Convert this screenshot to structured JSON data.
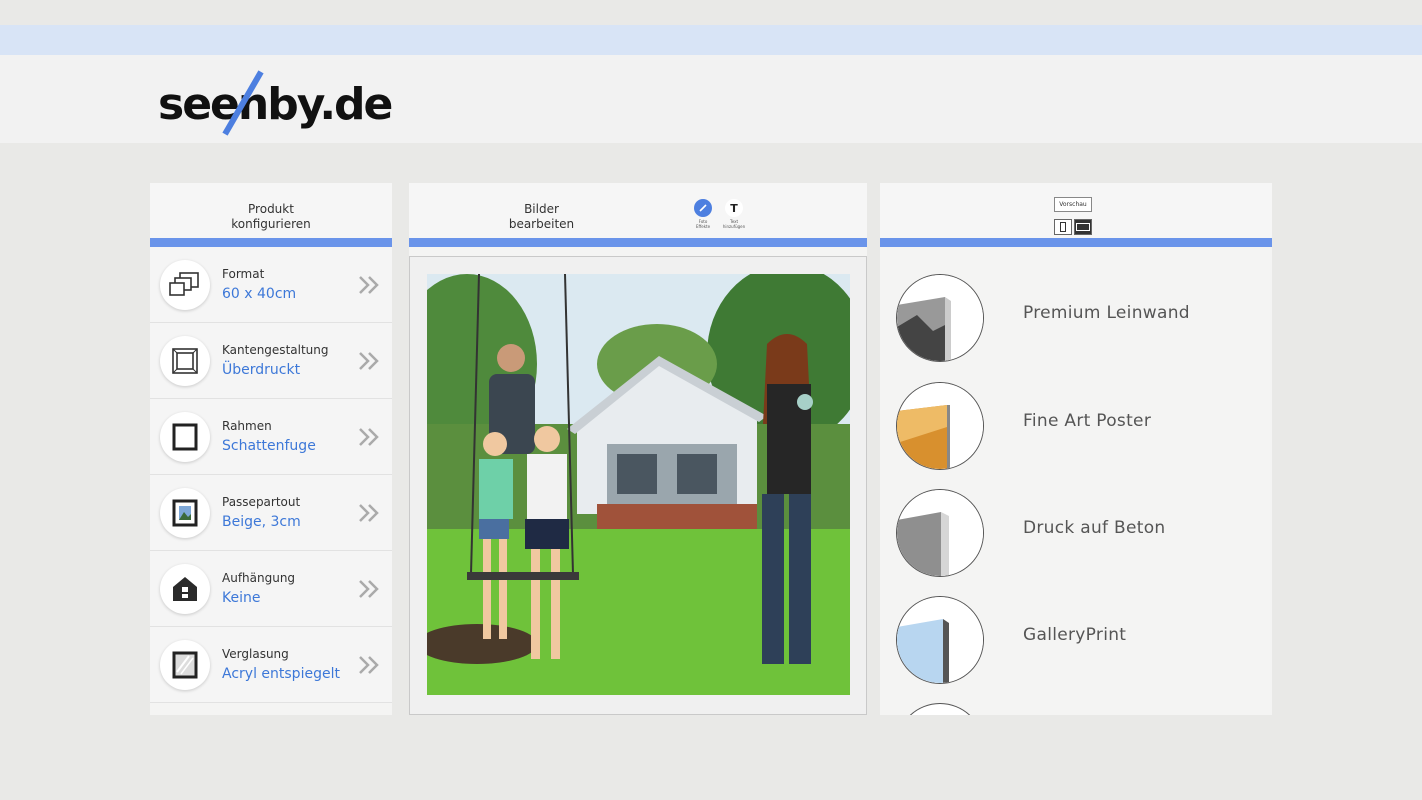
{
  "brand": {
    "logo_text": "seenby.de",
    "accent": "#4d7fe0"
  },
  "left_panel": {
    "title": "Produkt\nkonfigurieren",
    "options": [
      {
        "label": "Format",
        "value": "60 x 40cm",
        "icon": "format-icon"
      },
      {
        "label": "Kantengestaltung",
        "value": "Überdruckt",
        "icon": "edge-icon"
      },
      {
        "label": "Rahmen",
        "value": "Schattenfuge",
        "icon": "frame-icon"
      },
      {
        "label": "Passepartout",
        "value": "Beige, 3cm",
        "icon": "passepartout-icon"
      },
      {
        "label": "Aufhängung",
        "value": "Keine",
        "icon": "hanging-icon"
      },
      {
        "label": "Verglasung",
        "value": "Acryl entspiegelt",
        "icon": "glazing-icon"
      }
    ]
  },
  "middle_panel": {
    "title": "Bilder\nbearbeiten",
    "tools": [
      {
        "label": "Foto\nEffekte",
        "icon": "pencil-icon",
        "active": true
      },
      {
        "label": "Text\nhinzufügen",
        "icon": "text-icon",
        "glyph": "T",
        "active": false
      }
    ]
  },
  "right_panel": {
    "preview_label": "Vorschau",
    "materials": [
      {
        "name": "Premium Leinwand"
      },
      {
        "name": "Fine Art Poster"
      },
      {
        "name": "Druck auf Beton"
      },
      {
        "name": "GalleryPrint"
      }
    ]
  },
  "colors": {
    "accent_bar": "#6a94ea",
    "value_text": "#3d78d8",
    "top_strip": "#d8e4f6"
  }
}
